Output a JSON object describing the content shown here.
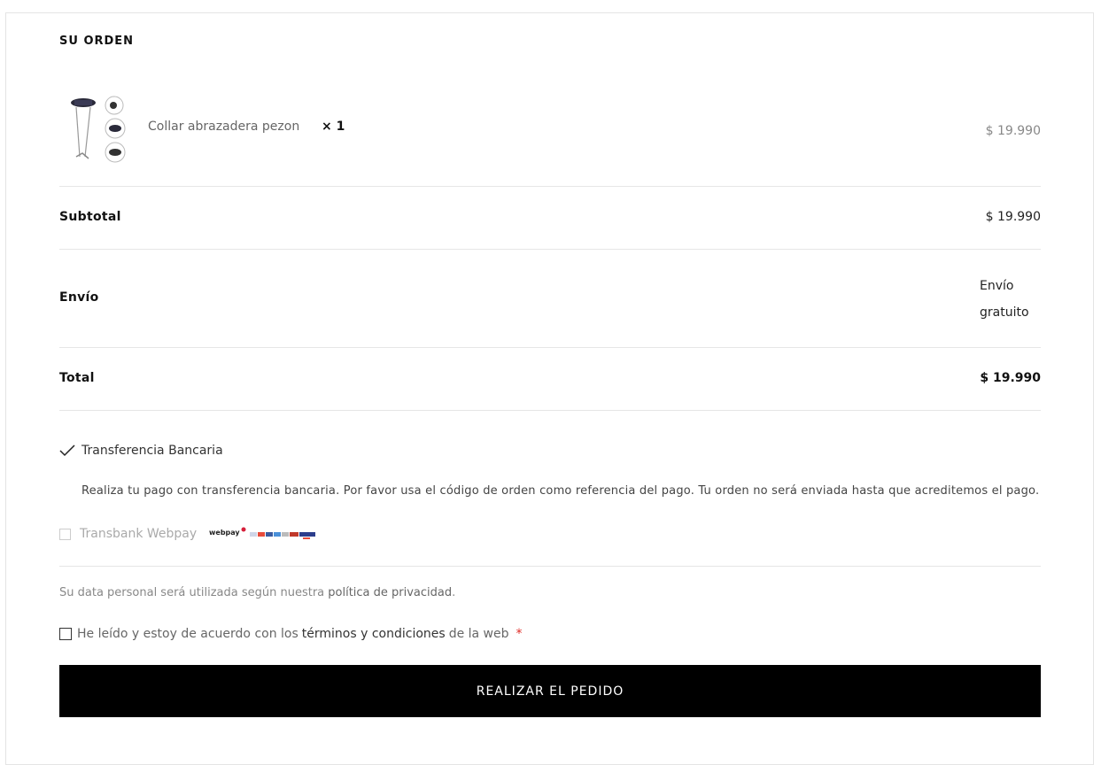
{
  "order": {
    "heading": "SU ORDEN",
    "item": {
      "name": "Collar abrazadera pezon",
      "quantity": "× 1",
      "price": "$  19.990"
    },
    "subtotal": {
      "label": "Subtotal",
      "value": "$  19.990"
    },
    "shipping": {
      "label": "Envío",
      "value_line1": "Envío",
      "value_line2": "gratuito"
    },
    "total": {
      "label": "Total",
      "value": "$  19.990"
    }
  },
  "payment": {
    "options": [
      {
        "label": "Transferencia Bancaria",
        "selected": true,
        "description": "Realiza tu pago con transferencia bancaria. Por favor usa el código de orden como referencia del pago. Tu orden no será enviada hasta que acreditemos el pago."
      },
      {
        "label": "Transbank Webpay",
        "selected": false,
        "logo_text": "webpay"
      }
    ]
  },
  "privacy": {
    "text_before": "Su data personal será utilizada según nuestra ",
    "link": "política de privacidad",
    "text_after": "."
  },
  "terms": {
    "text_before": "He leído y estoy de acuerdo con los",
    "link": "términos y condiciones",
    "text_after": "de la web",
    "required_mark": "*",
    "checked": false
  },
  "place_order_button": "REALIZAR EL PEDIDO",
  "colors": {
    "button_bg": "#000000",
    "required": "#e02b27",
    "border": "#e6e6e6"
  }
}
